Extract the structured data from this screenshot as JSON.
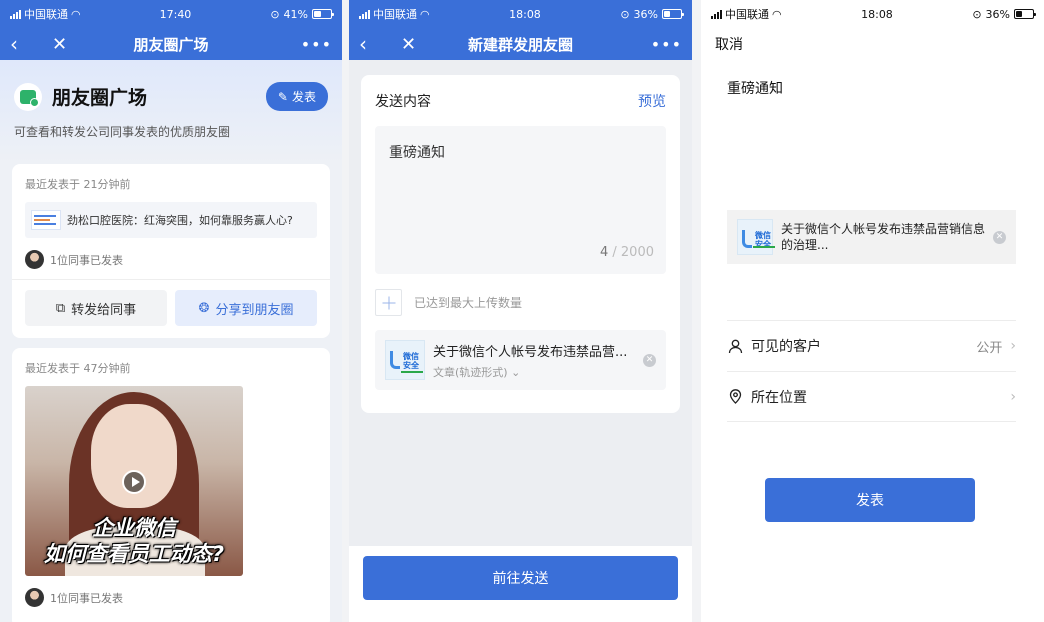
{
  "screen1": {
    "status": {
      "carrier": "中国联通",
      "time": "17:40",
      "battery": "41%"
    },
    "nav": {
      "title": "朋友圈广场",
      "more": "•••"
    },
    "hero": {
      "title": "朋友圈广场",
      "post_button": "发表",
      "subtitle": "可查看和转发公司同事发表的优质朋友圈"
    },
    "cards": [
      {
        "time": "最近发表于 21分钟前",
        "article_title": "劲松口腔医院：红海突围，如何靠服务赢人心?",
        "shared": "1位同事已发表",
        "forward_button": "转发给同事",
        "share_button": "分享到朋友圈"
      },
      {
        "time": "最近发表于 47分钟前",
        "video_caption_1": "企业微信",
        "video_caption_2": "如何查看员工动态?",
        "shared": "1位同事已发表"
      }
    ]
  },
  "screen2": {
    "status": {
      "carrier": "中国联通",
      "time": "18:08",
      "battery": "36%"
    },
    "nav": {
      "title": "新建群发朋友圈",
      "more": "•••"
    },
    "content_label": "发送内容",
    "preview_link": "预览",
    "editor_text": "重磅通知",
    "counter_current": "4",
    "counter_max": " / 2000",
    "upload_text": "已达到最大上传数量",
    "attachment": {
      "title": "关于微信个人帐号发布违禁品营...",
      "subtitle": "文章(轨迹形式)",
      "thumb_text": "微信安全"
    },
    "send_button": "前往发送"
  },
  "screen3": {
    "status": {
      "carrier": "中国联通",
      "time": "18:08",
      "battery": "36%"
    },
    "cancel": "取消",
    "text": "重磅通知",
    "attachment_title": "关于微信个人帐号发布违禁品营销信息的治理...",
    "rows": [
      {
        "label": "可见的客户",
        "value": "公开"
      },
      {
        "label": "所在位置",
        "value": ""
      }
    ],
    "post_button": "发表"
  },
  "colors": {
    "brand": "#3a6fd8",
    "brand_light": "#e6edfc",
    "wechat_green": "#2db26a"
  }
}
